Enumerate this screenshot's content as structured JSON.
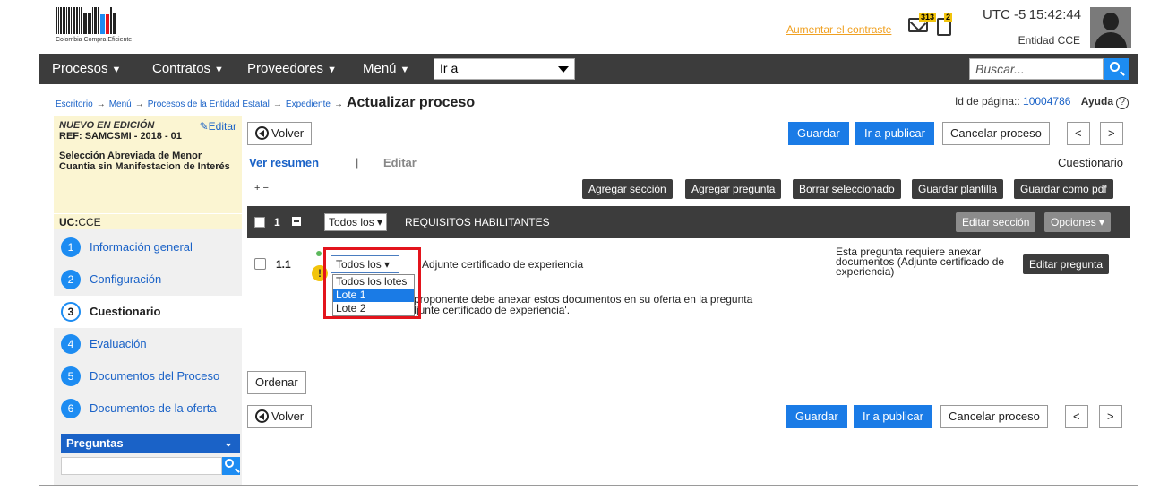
{
  "header": {
    "logo_text": "Colombia Compra Eficiente",
    "contrast_link": "Aumentar el contraste",
    "mail_count": "313",
    "doc_count": "2",
    "utc_label": "UTC -5",
    "time": "15:42:44",
    "entity": "Entidad CCE"
  },
  "nav": {
    "items": [
      "Procesos",
      "Contratos",
      "Proveedores",
      "Menú"
    ],
    "goto_value": "Ir a",
    "search_placeholder": "Buscar..."
  },
  "breadcrumb": {
    "items": [
      "Escritorio",
      "Menú",
      "Procesos de la Entidad Estatal",
      "Expediente"
    ],
    "current": "Actualizar proceso",
    "page_id_label": "Id de página::",
    "page_id": "10004786",
    "help": "Ayuda"
  },
  "sidebar": {
    "state": "NUEVO EN EDICIÓN",
    "edit": "Editar",
    "ref": "REF: SAMCSMI - 2018 - 01",
    "description": "Selección Abreviada de Menor Cuantia sin Manifestacion de Interés",
    "uc_label": "UC:",
    "uc_value": "CCE",
    "steps": [
      {
        "num": "1",
        "label": "Información general"
      },
      {
        "num": "2",
        "label": "Configuración"
      },
      {
        "num": "3",
        "label": "Cuestionario"
      },
      {
        "num": "4",
        "label": "Evaluación"
      },
      {
        "num": "5",
        "label": "Documentos del Proceso"
      },
      {
        "num": "6",
        "label": "Documentos de la oferta"
      }
    ],
    "preguntas": "Preguntas"
  },
  "toolbar": {
    "back": "Volver",
    "save": "Guardar",
    "publish": "Ir a publicar",
    "cancel": "Cancelar proceso",
    "prev": "<",
    "next": ">"
  },
  "tabs": {
    "summary": "Ver resumen",
    "separator": "|",
    "edit": "Editar",
    "section_name": "Cuestionario",
    "expand": "+ −"
  },
  "actions": {
    "add_section": "Agregar sección",
    "add_question": "Agregar pregunta",
    "delete_selected": "Borrar seleccionado",
    "save_template": "Guardar plantilla",
    "save_pdf": "Guardar como pdf"
  },
  "section": {
    "number": "1",
    "lot_select": "Todos los ▾",
    "title": "REQUISITOS HABILITANTES",
    "edit_section": "Editar sección",
    "options": "Opciones"
  },
  "question": {
    "number": "1.1",
    "lot_select": "Todos los ▾",
    "text": "Adjunte certificado de experiencia",
    "note": "El proponente debe anexar estos documentos en su oferta en la pregunta 'Adjunte certificado de experiencia'.",
    "requirement": "Esta pregunta requiere anexar documentos (Adjunte certificado de experiencia)",
    "edit_question": "Editar pregunta",
    "lot_options": [
      "Todos los lotes",
      "Lote 1",
      "Lote 2"
    ]
  },
  "bottom": {
    "order": "Ordenar"
  },
  "colors": {
    "nav_bg": "#3c3c3c",
    "primary": "#1a7be6",
    "highlight": "#e3141c",
    "sidebar_note_bg": "#fbf5d2"
  }
}
